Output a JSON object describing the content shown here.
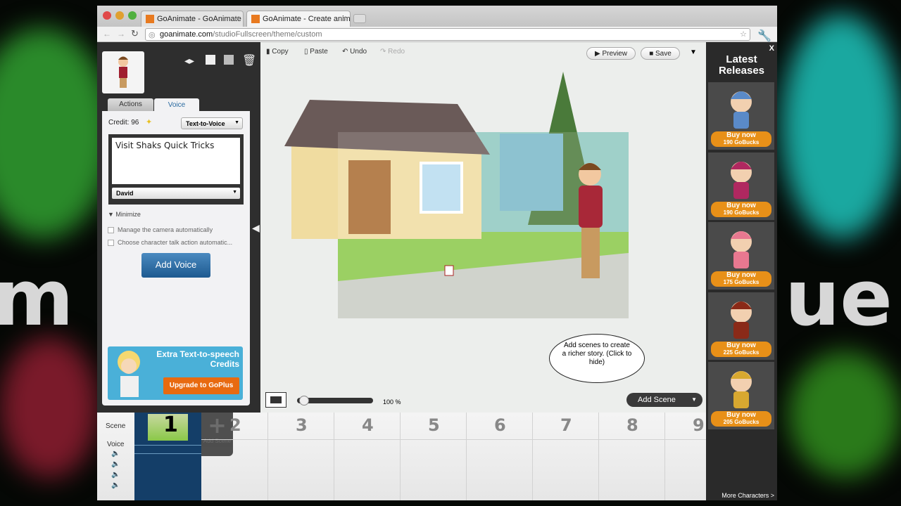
{
  "browser": {
    "tabs": [
      {
        "label": "GoAnimate - GoAnimate The"
      },
      {
        "label": "GoAnimate - Create animati"
      }
    ],
    "url_host": "goanimate.com",
    "url_path": "/studioFullscreen/theme/custom"
  },
  "background_text": {
    "left": "m",
    "right": "ue"
  },
  "character_panel": {
    "tabs": [
      {
        "label": "Actions"
      },
      {
        "label": "Voice"
      }
    ],
    "active_tab": "Voice",
    "credit_label": "Credit: 96",
    "voice_mode": "Text-to-Voice",
    "speech_text": "Visit Shaks Quick Tricks",
    "voice_name": "David",
    "minimize_label": "Minimize",
    "options": [
      {
        "label": "Manage the camera automatically",
        "checked": false
      },
      {
        "label": "Choose character talk action automatic...",
        "checked": false
      }
    ],
    "add_voice_label": "Add Voice",
    "promo_title": "Extra Text-to-speech Credits",
    "promo_button": "Upgrade to GoPlus"
  },
  "toolbar": {
    "copy": "Copy",
    "paste": "Paste",
    "undo": "Undo",
    "redo": "Redo",
    "preview": "Preview",
    "save": "Save"
  },
  "stage": {
    "tooltip": "Add scenes to create a richer story. (Click to hide)",
    "zoom_label": "100 %",
    "zoom_fraction": 0.03,
    "add_scene": "Add Scene"
  },
  "timeline": {
    "scene_label": "Scene",
    "voice_label": "Voice",
    "current_scene": "1",
    "add_scene_ghost": "Add Scene",
    "scene_numbers": [
      "2",
      "3",
      "4",
      "5",
      "6",
      "7",
      "8",
      "9"
    ]
  },
  "sidebar": {
    "close": "X",
    "title": "Latest Releases",
    "items": [
      {
        "buy": "Buy now",
        "price": "190 GoBucks",
        "color": "#5a8ac8"
      },
      {
        "buy": "Buy now",
        "price": "190 GoBucks",
        "color": "#b02860"
      },
      {
        "buy": "Buy now",
        "price": "175 GoBucks",
        "color": "#e87890"
      },
      {
        "buy": "Buy now",
        "price": "225 GoBucks",
        "color": "#8a2a18"
      },
      {
        "buy": "Buy now",
        "price": "205 GoBucks",
        "color": "#d8a830"
      }
    ],
    "more": "More Characters >"
  }
}
